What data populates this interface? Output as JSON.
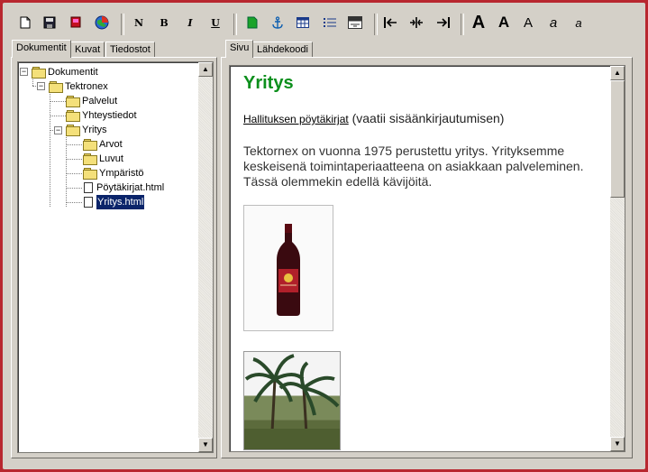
{
  "toolbar": {
    "buttons": [
      {
        "name": "new-document-button",
        "icon": "new-page-icon"
      },
      {
        "name": "save-button",
        "icon": "floppy-disk-icon"
      },
      {
        "name": "red-tool-button",
        "icon": "red-square-icon"
      },
      {
        "name": "globe-button",
        "icon": "globe-icon"
      },
      {
        "name": "normal-text-button",
        "label": "N"
      },
      {
        "name": "bold-button",
        "label": "B"
      },
      {
        "name": "italic-button",
        "label": "I"
      },
      {
        "name": "underline-button",
        "label": "U"
      },
      {
        "name": "insert-image-button",
        "icon": "image-icon"
      },
      {
        "name": "anchor-button",
        "icon": "anchor-icon"
      },
      {
        "name": "table-button",
        "icon": "table-icon"
      },
      {
        "name": "bullet-list-button",
        "icon": "list-icon"
      },
      {
        "name": "abc-button",
        "icon": "spellcheck-icon"
      },
      {
        "name": "align-left-button",
        "icon": "align-left-icon"
      },
      {
        "name": "align-center-button",
        "icon": "align-center-icon"
      },
      {
        "name": "align-right-button",
        "icon": "align-right-icon"
      },
      {
        "name": "font-large-button",
        "label": "A"
      },
      {
        "name": "font-medium-button",
        "label": "A"
      },
      {
        "name": "font-small-button",
        "label": "A"
      },
      {
        "name": "italic-a-large-button",
        "label": "a"
      },
      {
        "name": "italic-a-small-button",
        "label": "a"
      }
    ]
  },
  "left_tabs": [
    "Dokumentit",
    "Kuvat",
    "Tiedostot"
  ],
  "right_tabs": [
    "Sivu",
    "Lähdekoodi"
  ],
  "tree": [
    {
      "label": "Dokumentit",
      "type": "folder"
    },
    {
      "label": "Tektronex",
      "type": "folder"
    },
    {
      "label": "Palvelut",
      "type": "folder"
    },
    {
      "label": "Yhteystiedot",
      "type": "folder"
    },
    {
      "label": "Yritys",
      "type": "folder"
    },
    {
      "label": "Arvot",
      "type": "folder"
    },
    {
      "label": "Luvut",
      "type": "folder"
    },
    {
      "label": "Ympäristö",
      "type": "folder"
    },
    {
      "label": "Pöytäkirjat.html",
      "type": "file"
    },
    {
      "label": "Yritys.html",
      "type": "file",
      "selected": true
    }
  ],
  "content": {
    "heading": "Yritys",
    "link": "Hallituksen pöytäkirjat",
    "link_suffix": " (vaatii sisäänkirjautumisen)",
    "paragraph": "Tektornex on vuonna 1975 perustettu yritys. Yrityksemme keskeisenä toimintaperiaatteena on asiakkaan palveleminen. Tässä olemmekin edellä kävijöitä.",
    "heading_color": "#0c8f1c"
  }
}
